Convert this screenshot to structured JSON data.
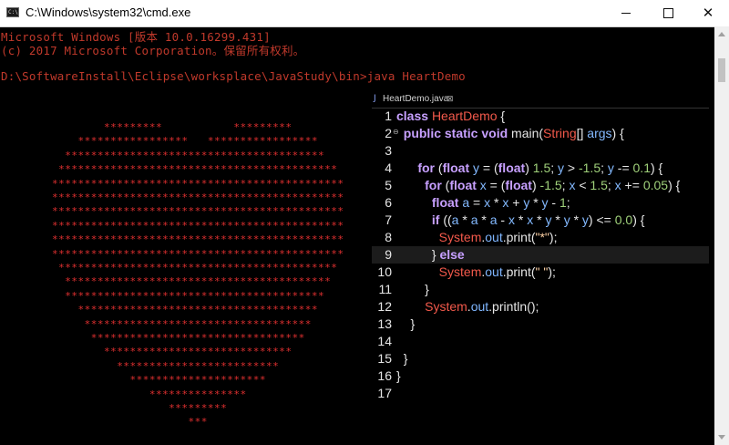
{
  "window": {
    "title": "C:\\Windows\\system32\\cmd.exe",
    "icon_text": "C:\\",
    "controls": {
      "minimize": "minimize",
      "maximize": "maximize",
      "close": "✕"
    }
  },
  "console": {
    "lines": [
      "Microsoft Windows [版本 10.0.16299.431]",
      "(c) 2017 Microsoft Corporation。保留所有权利。",
      "",
      "D:\\SoftwareInstall\\Eclipse\\worksplace\\JavaStudy\\bin>java HeartDemo"
    ]
  },
  "heart": {
    "char": "*",
    "color": "#e03030"
  },
  "editor": {
    "tab_label": "HeartDemo.java",
    "tab_close": "⊠",
    "highlight_line": 9,
    "lines": [
      [
        {
          "t": "kw",
          "s": "class "
        },
        {
          "t": "name",
          "s": "HeartDemo"
        },
        {
          "t": "plain",
          "s": " {"
        }
      ],
      [
        {
          "t": "kw",
          "s": "  public static void "
        },
        {
          "t": "plain",
          "s": "main("
        },
        {
          "t": "name",
          "s": "String"
        },
        {
          "t": "plain",
          "s": "[] "
        },
        {
          "t": "var",
          "s": "args"
        },
        {
          "t": "plain",
          "s": ") {"
        }
      ],
      [],
      [
        {
          "t": "kw",
          "s": "      for "
        },
        {
          "t": "plain",
          "s": "("
        },
        {
          "t": "kw",
          "s": "float "
        },
        {
          "t": "var",
          "s": "y"
        },
        {
          "t": "plain",
          "s": " = ("
        },
        {
          "t": "kw",
          "s": "float"
        },
        {
          "t": "plain",
          "s": ") "
        },
        {
          "t": "num",
          "s": "1.5"
        },
        {
          "t": "plain",
          "s": "; "
        },
        {
          "t": "var",
          "s": "y"
        },
        {
          "t": "plain",
          "s": " > "
        },
        {
          "t": "num",
          "s": "-1.5"
        },
        {
          "t": "plain",
          "s": "; "
        },
        {
          "t": "var",
          "s": "y"
        },
        {
          "t": "plain",
          "s": " -= "
        },
        {
          "t": "num",
          "s": "0.1"
        },
        {
          "t": "plain",
          "s": ") {"
        }
      ],
      [
        {
          "t": "kw",
          "s": "        for "
        },
        {
          "t": "plain",
          "s": "("
        },
        {
          "t": "kw",
          "s": "float "
        },
        {
          "t": "var",
          "s": "x"
        },
        {
          "t": "plain",
          "s": " = ("
        },
        {
          "t": "kw",
          "s": "float"
        },
        {
          "t": "plain",
          "s": ") "
        },
        {
          "t": "num",
          "s": "-1.5"
        },
        {
          "t": "plain",
          "s": "; "
        },
        {
          "t": "var",
          "s": "x"
        },
        {
          "t": "plain",
          "s": " < "
        },
        {
          "t": "num",
          "s": "1.5"
        },
        {
          "t": "plain",
          "s": "; "
        },
        {
          "t": "var",
          "s": "x"
        },
        {
          "t": "plain",
          "s": " += "
        },
        {
          "t": "num",
          "s": "0.05"
        },
        {
          "t": "plain",
          "s": ") {"
        }
      ],
      [
        {
          "t": "kw",
          "s": "          float "
        },
        {
          "t": "var",
          "s": "a"
        },
        {
          "t": "plain",
          "s": " = "
        },
        {
          "t": "var",
          "s": "x"
        },
        {
          "t": "plain",
          "s": " * "
        },
        {
          "t": "var",
          "s": "x"
        },
        {
          "t": "plain",
          "s": " + "
        },
        {
          "t": "var",
          "s": "y"
        },
        {
          "t": "plain",
          "s": " * "
        },
        {
          "t": "var",
          "s": "y"
        },
        {
          "t": "plain",
          "s": " - "
        },
        {
          "t": "num",
          "s": "1"
        },
        {
          "t": "plain",
          "s": ";"
        }
      ],
      [
        {
          "t": "kw",
          "s": "          if "
        },
        {
          "t": "plain",
          "s": "(("
        },
        {
          "t": "var",
          "s": "a"
        },
        {
          "t": "plain",
          "s": " * "
        },
        {
          "t": "var",
          "s": "a"
        },
        {
          "t": "plain",
          "s": " * "
        },
        {
          "t": "var",
          "s": "a"
        },
        {
          "t": "plain",
          "s": " - "
        },
        {
          "t": "var",
          "s": "x"
        },
        {
          "t": "plain",
          "s": " * "
        },
        {
          "t": "var",
          "s": "x"
        },
        {
          "t": "plain",
          "s": " * "
        },
        {
          "t": "var",
          "s": "y"
        },
        {
          "t": "plain",
          "s": " * "
        },
        {
          "t": "var",
          "s": "y"
        },
        {
          "t": "plain",
          "s": " * "
        },
        {
          "t": "var",
          "s": "y"
        },
        {
          "t": "plain",
          "s": ") <= "
        },
        {
          "t": "num",
          "s": "0.0"
        },
        {
          "t": "plain",
          "s": ") {"
        }
      ],
      [
        {
          "t": "sys",
          "s": "            System"
        },
        {
          "t": "plain",
          "s": "."
        },
        {
          "t": "field",
          "s": "out"
        },
        {
          "t": "plain",
          "s": ".print("
        },
        {
          "t": "str",
          "s": "\"*\""
        },
        {
          "t": "plain",
          "s": ");"
        }
      ],
      [
        {
          "t": "plain",
          "s": "          } "
        },
        {
          "t": "kw",
          "s": "else"
        }
      ],
      [
        {
          "t": "sys",
          "s": "            System"
        },
        {
          "t": "plain",
          "s": "."
        },
        {
          "t": "field",
          "s": "out"
        },
        {
          "t": "plain",
          "s": ".print("
        },
        {
          "t": "str",
          "s": "\" \""
        },
        {
          "t": "plain",
          "s": ");"
        }
      ],
      [
        {
          "t": "plain",
          "s": "        }"
        }
      ],
      [
        {
          "t": "sys",
          "s": "        System"
        },
        {
          "t": "plain",
          "s": "."
        },
        {
          "t": "field",
          "s": "out"
        },
        {
          "t": "plain",
          "s": ".println();"
        }
      ],
      [
        {
          "t": "plain",
          "s": "    }"
        }
      ],
      [],
      [
        {
          "t": "plain",
          "s": "  }"
        }
      ],
      [
        {
          "t": "plain",
          "s": "}"
        }
      ],
      []
    ]
  }
}
